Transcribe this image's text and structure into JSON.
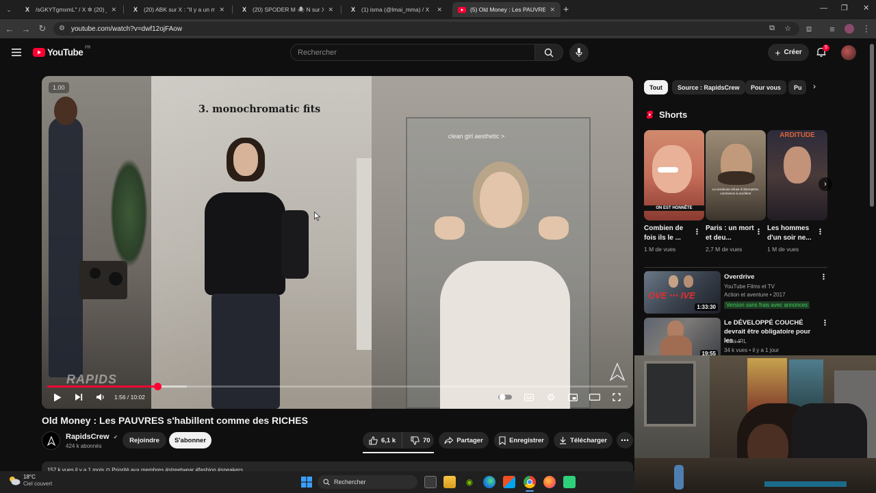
{
  "browser": {
    "tabs": [
      {
        "title": "/sGKYTgmxmL\" / X ✲ ليبر (20)",
        "icon": "x-logo-icon",
        "active": false
      },
      {
        "title": "(20) ABK sur X : \"Il y a un mec",
        "icon": "x-logo-icon",
        "active": false
      },
      {
        "title": "(20) SPODER M 🕷 N sur X : \"C'e",
        "icon": "x-logo-icon",
        "active": false
      },
      {
        "title": "(1) isma (@lmai_mma) / X",
        "icon": "x-logo-icon",
        "active": false
      },
      {
        "title": "(5) Old Money : Les PAUVRES s",
        "icon": "youtube-icon",
        "active": true
      }
    ],
    "new_tab": "+",
    "url": "youtube.com/watch?v=dwf12ojFAow"
  },
  "header": {
    "logo_text": "YouTube",
    "region": "FR",
    "search_placeholder": "Rechercher",
    "create_label": "Créer",
    "notification_count": "5"
  },
  "player": {
    "speed_label": "1.00",
    "overlay_text_1": "3. monochromatic fits",
    "overlay_text_2": "clean girl aesthetic >",
    "watermark": "RAPIDS",
    "time": "1:56 / 10:02",
    "progress": 0.19,
    "buffered": 0.24
  },
  "video": {
    "title": "Old Money : Les PAUVRES s'habillent comme des RICHES",
    "channel": "RapidsCrew",
    "subscribers": "424 k abonnés",
    "join_label": "Rejoindre",
    "subscribe_label": "S'abonner",
    "likes": "6,1 k",
    "dislikes": "70",
    "share_label": "Partager",
    "save_label": "Enregistrer",
    "download_label": "Télécharger",
    "description_line": "157 k vues  il y a 1 mois  ⊙ Priorité aux membres  #streetwear #fashion #sneakers"
  },
  "sidebar": {
    "chips": [
      "Tout",
      "Source : RapidsCrew",
      "Pour vous",
      "Pu"
    ],
    "shorts_heading": "Shorts",
    "shorts": [
      {
        "title": "Combien de fois ils le ...",
        "views": "1 M de vues",
        "thumb_caption": "ON EST HONNÊTE"
      },
      {
        "title": "Paris : un mort et deu...",
        "views": "2,7 M de vues",
        "thumb_caption": "La vendeuse refuse d'obtempérer, commence à accélérer"
      },
      {
        "title": "Les hommes d'un soir ne...",
        "views": "1 M de vues",
        "thumb_caption": "ARDITUDE"
      }
    ],
    "recommendations": [
      {
        "title": "Overdrive",
        "channel": "YouTube Films et TV",
        "meta": "Action et aventure • 2017",
        "badge": "Version sans frais avec annonces",
        "duration": "1:33:30"
      },
      {
        "title": "Le DÉVELOPPÉ COUCHÉ devrait être obligatoire pour les ...",
        "channel": "Nass IRL",
        "meta": "34 k vues • il y a 1 jour",
        "badge": "",
        "duration": "19:55"
      }
    ]
  },
  "taskbar": {
    "weather_temp": "18°C",
    "weather_desc": "Ciel couvert",
    "search_label": "Rechercher"
  },
  "colors": {
    "accent": "#ff0033",
    "background": "#0f0f0f",
    "chip_bg": "#272727",
    "badge_green": "#2ba640"
  }
}
